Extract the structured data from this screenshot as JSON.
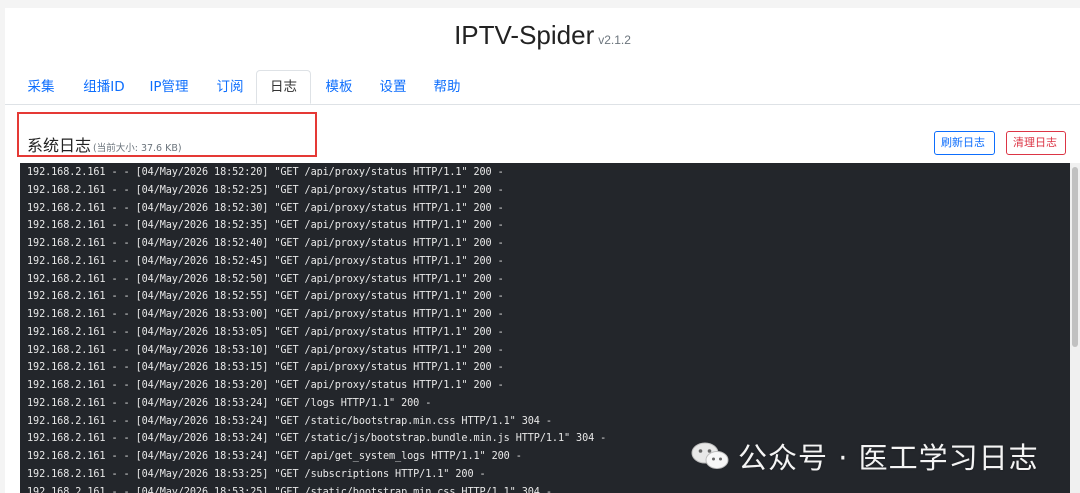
{
  "header": {
    "title": "IPTV-Spider",
    "version": "v2.1.2"
  },
  "tabs": [
    {
      "label": "采集"
    },
    {
      "label": "组播ID"
    },
    {
      "label": "IP管理"
    },
    {
      "label": "订阅"
    },
    {
      "label": "日志",
      "active": true
    },
    {
      "label": "模板"
    },
    {
      "label": "设置"
    },
    {
      "label": "帮助"
    }
  ],
  "log_section": {
    "title": "系统日志",
    "size_text": "(当前大小: 37.6 KB)",
    "refresh_label": "刷新日志",
    "clear_label": "清理日志"
  },
  "log_lines": [
    "192.168.2.161 - - [04/May/2026 18:52:20] \"GET /api/proxy/status HTTP/1.1\" 200 -",
    "192.168.2.161 - - [04/May/2026 18:52:25] \"GET /api/proxy/status HTTP/1.1\" 200 -",
    "192.168.2.161 - - [04/May/2026 18:52:30] \"GET /api/proxy/status HTTP/1.1\" 200 -",
    "192.168.2.161 - - [04/May/2026 18:52:35] \"GET /api/proxy/status HTTP/1.1\" 200 -",
    "192.168.2.161 - - [04/May/2026 18:52:40] \"GET /api/proxy/status HTTP/1.1\" 200 -",
    "192.168.2.161 - - [04/May/2026 18:52:45] \"GET /api/proxy/status HTTP/1.1\" 200 -",
    "192.168.2.161 - - [04/May/2026 18:52:50] \"GET /api/proxy/status HTTP/1.1\" 200 -",
    "192.168.2.161 - - [04/May/2026 18:52:55] \"GET /api/proxy/status HTTP/1.1\" 200 -",
    "192.168.2.161 - - [04/May/2026 18:53:00] \"GET /api/proxy/status HTTP/1.1\" 200 -",
    "192.168.2.161 - - [04/May/2026 18:53:05] \"GET /api/proxy/status HTTP/1.1\" 200 -",
    "192.168.2.161 - - [04/May/2026 18:53:10] \"GET /api/proxy/status HTTP/1.1\" 200 -",
    "192.168.2.161 - - [04/May/2026 18:53:15] \"GET /api/proxy/status HTTP/1.1\" 200 -",
    "192.168.2.161 - - [04/May/2026 18:53:20] \"GET /api/proxy/status HTTP/1.1\" 200 -",
    "192.168.2.161 - - [04/May/2026 18:53:24] \"GET /logs HTTP/1.1\" 200 -",
    "192.168.2.161 - - [04/May/2026 18:53:24] \"GET /static/bootstrap.min.css HTTP/1.1\" 304 -",
    "192.168.2.161 - - [04/May/2026 18:53:24] \"GET /static/js/bootstrap.bundle.min.js HTTP/1.1\" 304 -",
    "192.168.2.161 - - [04/May/2026 18:53:24] \"GET /api/get_system_logs HTTP/1.1\" 200 -",
    "192.168.2.161 - - [04/May/2026 18:53:25] \"GET /subscriptions HTTP/1.1\" 200 -",
    "192.168.2.161 - - [04/May/2026 18:53:25] \"GET /static/bootstrap.min.css HTTP/1.1\" 304 -"
  ],
  "watermark": {
    "text": "公众号 · 医工学习日志",
    "icon": "wechat-icon"
  },
  "colors": {
    "accent": "#0d6efd",
    "danger": "#dc3545",
    "log_bg": "#23262b",
    "highlight": "#e53935"
  }
}
